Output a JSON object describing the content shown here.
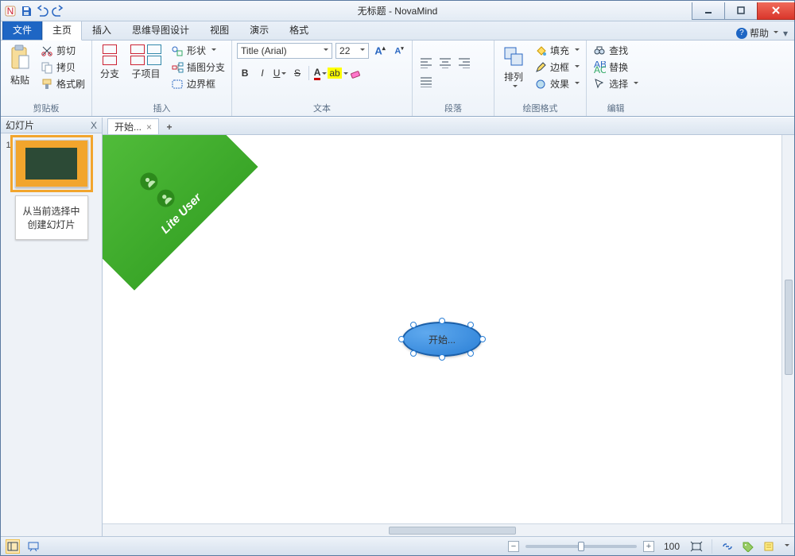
{
  "titlebar": {
    "title": "无标题 - NovaMind"
  },
  "qat": {
    "save": "保存",
    "undo": "撤销",
    "redo": "重做"
  },
  "tabs": {
    "file": "文件",
    "home": "主页",
    "insert": "插入",
    "design": "思维导图设计",
    "view": "视图",
    "present": "演示",
    "format": "格式"
  },
  "help": {
    "label": "帮助"
  },
  "groups": {
    "clipboard": {
      "label": "剪贴板",
      "paste": "粘贴",
      "cut": "剪切",
      "copy": "拷贝",
      "formatPainter": "格式刷"
    },
    "insert": {
      "label": "插入",
      "branch": "分支",
      "subitem": "子项目",
      "shape": "形状",
      "subBranch": "插图分支",
      "border": "边界框"
    },
    "text": {
      "label": "文本",
      "fontName": "Title (Arial)",
      "fontSize": "22"
    },
    "paragraph": {
      "label": "段落"
    },
    "drawfmt": {
      "label": "绘图格式",
      "arrange": "排列",
      "fill": "填充",
      "outline": "边框",
      "effects": "效果"
    },
    "edit": {
      "label": "编辑",
      "find": "查找",
      "replace": "替换",
      "select": "选择"
    }
  },
  "sidepanel": {
    "title": "幻灯片",
    "close": "X",
    "thumb2": "从当前选择中创建幻灯片",
    "slideNum": "1"
  },
  "doctab": {
    "label": "开始..."
  },
  "banner": {
    "text": "Lite User"
  },
  "node": {
    "text": "开始..."
  },
  "status": {
    "zoom": "100"
  }
}
